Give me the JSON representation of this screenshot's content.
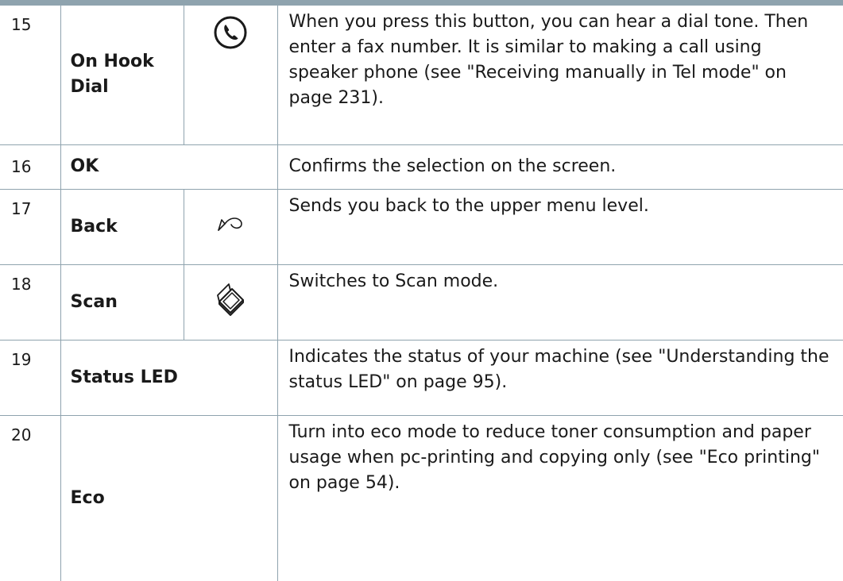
{
  "rows": [
    {
      "number": "15",
      "name_line1": "On Hook",
      "name_line2": "Dial",
      "icon": "phone-handset-icon",
      "description": "When you press this button, you can hear a dial tone. Then enter a fax number. It is similar to making a call using speaker phone (see \"Receiving manually in Tel mode\" on page 231)."
    },
    {
      "number": "16",
      "name": "OK",
      "description": "Confirms the selection on the screen."
    },
    {
      "number": "17",
      "name": "Back",
      "icon": "back-arrow-icon",
      "description": "Sends you back to the upper menu level."
    },
    {
      "number": "18",
      "name": "Scan",
      "icon": "scanner-icon",
      "description": "Switches to Scan mode."
    },
    {
      "number": "19",
      "name": "Status LED",
      "description": "Indicates the status of your machine (see \"Understanding the status LED\" on page 95)."
    },
    {
      "number": "20",
      "name": "Eco",
      "description": "Turn into eco mode to reduce toner consumption and paper usage when pc-printing and copying only (see \"Eco printing\" on page 54)."
    }
  ],
  "colors": {
    "rule": "#8fa3ae",
    "text": "#1a1a1a"
  }
}
